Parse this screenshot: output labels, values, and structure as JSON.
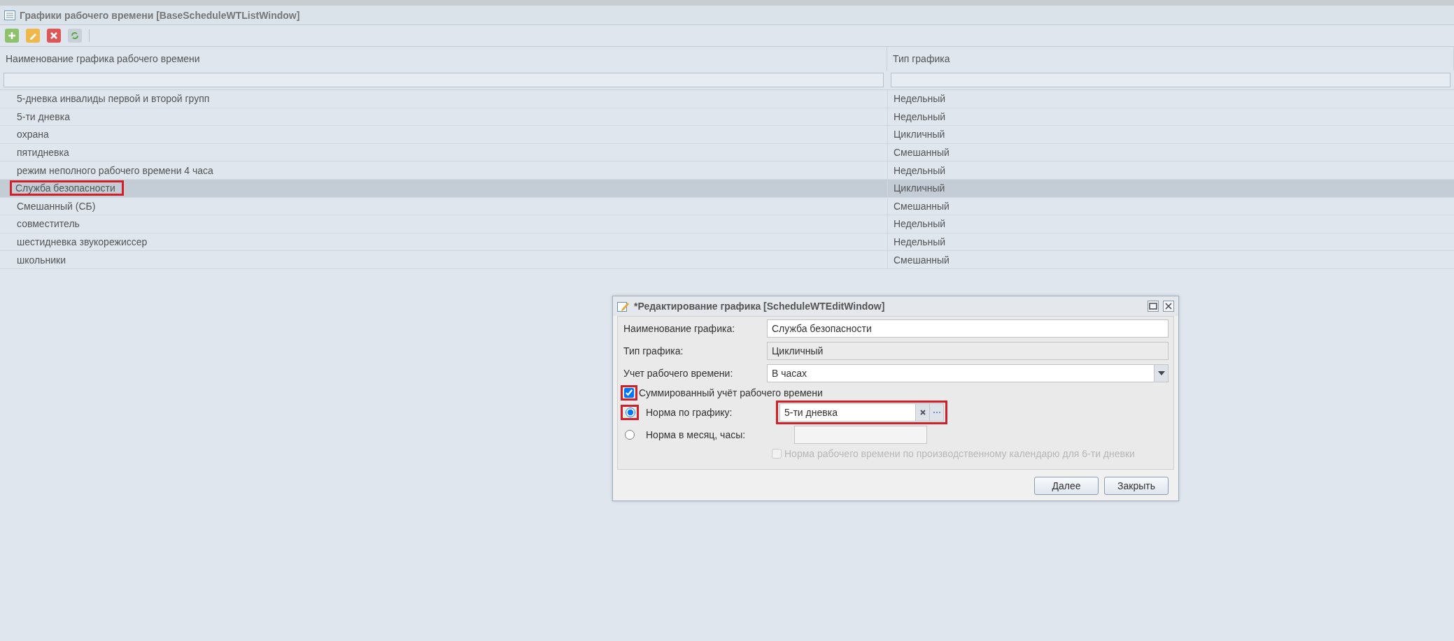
{
  "window": {
    "title": "Графики рабочего времени [BaseScheduleWTListWindow]"
  },
  "toolbar": [
    {
      "kind": "add"
    },
    {
      "kind": "edit"
    },
    {
      "kind": "delete"
    },
    {
      "kind": "refresh"
    }
  ],
  "table": {
    "columns": [
      "Наименование графика рабочего времени",
      "Тип графика"
    ],
    "rows": [
      {
        "name": "5-дневка инвалиды первой и второй групп",
        "type": "Недельный",
        "selected": false,
        "highlighted": false
      },
      {
        "name": "5-ти дневка",
        "type": "Недельный",
        "selected": false,
        "highlighted": false
      },
      {
        "name": "охрана",
        "type": "Цикличный",
        "selected": false,
        "highlighted": false
      },
      {
        "name": "пятидневка",
        "type": "Смешанный",
        "selected": false,
        "highlighted": false
      },
      {
        "name": "режим неполного рабочего времени 4 часа",
        "type": "Недельный",
        "selected": false,
        "highlighted": false
      },
      {
        "name": "Служба безопасности",
        "type": "Цикличный",
        "selected": true,
        "highlighted": true
      },
      {
        "name": "Смешанный (СБ)",
        "type": "Смешанный",
        "selected": false,
        "highlighted": false
      },
      {
        "name": "совместитель",
        "type": "Недельный",
        "selected": false,
        "highlighted": false
      },
      {
        "name": "шестидневка звукорежиссер",
        "type": "Недельный",
        "selected": false,
        "highlighted": false
      },
      {
        "name": "школьники",
        "type": "Смешанный",
        "selected": false,
        "highlighted": false
      }
    ]
  },
  "dialog": {
    "title": "*Редактирование графика [ScheduleWTEditWindow]",
    "fields": [
      {
        "label": "Наименование графика:",
        "value": "Служба безопасности",
        "kind": "text"
      },
      {
        "label": "Тип графика:",
        "value": "Цикличный",
        "kind": "readonly"
      },
      {
        "label": "Учет рабочего времени:",
        "value": "В часах",
        "kind": "combo"
      }
    ],
    "summed": {
      "label": "Суммированный учёт рабочего времени",
      "checked": true,
      "highlighted": true
    },
    "norms": [
      {
        "label": "Норма по графику:",
        "kind": "lookup",
        "value": "5-ти дневка",
        "selected": true,
        "highlighted": true
      },
      {
        "label": "Норма в месяц, часы:",
        "kind": "number",
        "selected": false,
        "highlighted": false
      }
    ],
    "calendar": {
      "label": "Норма рабочего времени по производственному календарю для 6-ти дневки",
      "checked": false,
      "disabled": true
    },
    "buttons": [
      "Далее",
      "Закрыть"
    ]
  }
}
